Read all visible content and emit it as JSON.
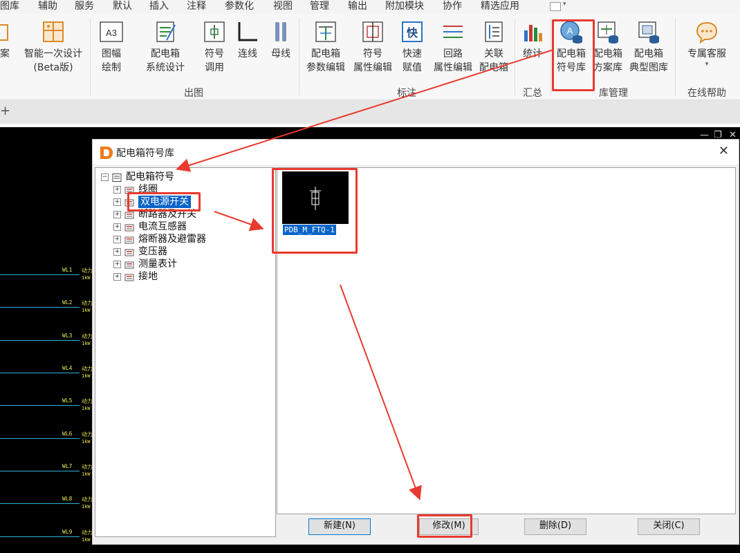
{
  "menu": [
    "图库",
    "辅助",
    "服务",
    "默认",
    "插入",
    "注释",
    "参数化",
    "视图",
    "管理",
    "输出",
    "附加模块",
    "协作",
    "精选应用"
  ],
  "ribbon": {
    "buttons": {
      "case_partial": [
        "案"
      ],
      "smart_design": [
        "智能一次设计",
        "(Beta版)"
      ],
      "frame_draw": [
        "图幅",
        "绘制"
      ],
      "dist_box_system": [
        "配电箱",
        "系统设计"
      ],
      "symbol_call": [
        "符号",
        "调用"
      ],
      "connect": [
        "连线"
      ],
      "busbar": [
        "母线"
      ],
      "param_edit": [
        "配电箱",
        "参数编辑"
      ],
      "attr_edit": [
        "符号",
        "属性编辑"
      ],
      "quick_assign": [
        "快速",
        "赋值"
      ],
      "circuit_attr": [
        "回路",
        "属性编辑"
      ],
      "link_box": [
        "关联",
        "配电箱"
      ],
      "stats": [
        "统计"
      ],
      "symbol_lib": [
        "配电箱",
        "符号库"
      ],
      "scheme_lib": [
        "配电箱",
        "方案库"
      ],
      "typical_lib": [
        "配电箱",
        "典型图库"
      ],
      "support": [
        "专属客服"
      ]
    },
    "groups": {
      "output": "出图",
      "annotate": "标注",
      "summary": "汇总",
      "lib_manage": "库管理",
      "help": "在线帮助"
    },
    "frame_icon_text": "A3",
    "quick_icon_text": "快"
  },
  "cad": {
    "wl_labels": [
      "WL1",
      "WL2",
      "WL3",
      "WL4",
      "WL5",
      "WL6",
      "WL7",
      "WL8",
      "WL9"
    ],
    "wl_text": "动力",
    "wl_sub": "1kW"
  },
  "dialog": {
    "title": "配电箱符号库",
    "tree": {
      "root": "配电箱符号",
      "items": [
        "线圈",
        "双电源开关",
        "断路器及开关",
        "电流互感器",
        "熔断器及避雷器",
        "变压器",
        "测量表计",
        "接地"
      ],
      "selected_index": 1
    },
    "preview": {
      "symbol_name": "PDB_M_FTQ-1"
    },
    "buttons": {
      "new": "新建(N)",
      "modify": "修改(M)",
      "delete": "删除(D)",
      "close": "关闭(C)"
    }
  },
  "colors": {
    "highlight": "#e83a2e",
    "selection": "#0a64c8",
    "wl_line": "#2fb3d4",
    "cad_text": "#e7e74a"
  }
}
